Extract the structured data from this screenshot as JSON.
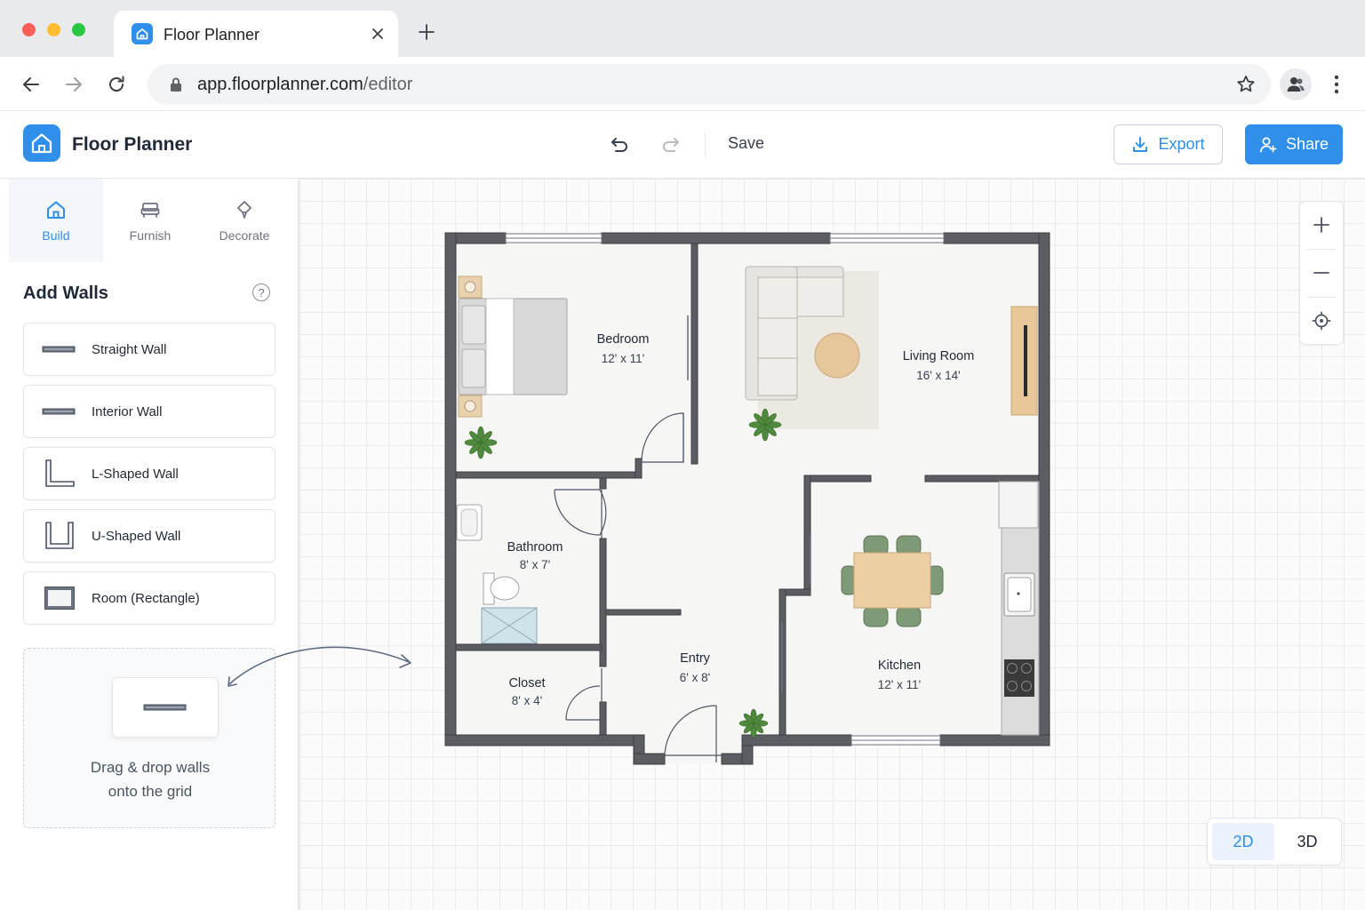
{
  "browser": {
    "tab_title": "Floor Planner",
    "url_host": "app.floorplanner.com",
    "url_path": "/editor"
  },
  "header": {
    "title": "Floor Planner",
    "save_label": "Save",
    "export_label": "Export",
    "share_label": "Share"
  },
  "sidebar": {
    "tabs": [
      {
        "label": "Build",
        "icon": "home-icon",
        "active": true
      },
      {
        "label": "Furnish",
        "icon": "sofa-icon",
        "active": false
      },
      {
        "label": "Decorate",
        "icon": "diamond-icon",
        "active": false
      }
    ],
    "section_title": "Add Walls",
    "help": "?",
    "wall_tools": [
      {
        "label": "Straight Wall",
        "icon": "straight-wall-icon"
      },
      {
        "label": "Interior Wall",
        "icon": "interior-wall-icon"
      },
      {
        "label": "L-Shaped Wall",
        "icon": "l-shaped-wall-icon"
      },
      {
        "label": "U-Shaped Wall",
        "icon": "u-shaped-wall-icon"
      },
      {
        "label": "Room (Rectangle)",
        "icon": "room-rectangle-icon"
      }
    ],
    "drop_hint_line1": "Drag & drop walls",
    "drop_hint_line2": "onto the grid"
  },
  "floor_plan": {
    "rooms": [
      {
        "name": "Bedroom",
        "dims": "12' x 11'"
      },
      {
        "name": "Living Room",
        "dims": "16' x 14'"
      },
      {
        "name": "Bathroom",
        "dims": "8' x 7'"
      },
      {
        "name": "Entry",
        "dims": "6' x 8'"
      },
      {
        "name": "Closet",
        "dims": "8' x 4'"
      },
      {
        "name": "Kitchen",
        "dims": "12' x 11'"
      }
    ]
  },
  "view_toggle": {
    "options": [
      "2D",
      "3D"
    ],
    "active": "2D"
  },
  "colors": {
    "accent": "#2f8fea",
    "wall": "#5a5d61",
    "plant": "#4f8a3c"
  }
}
